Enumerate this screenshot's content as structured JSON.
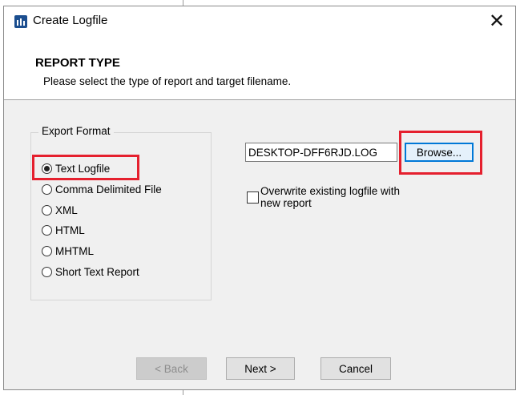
{
  "window": {
    "title": "Create Logfile",
    "close_glyph": "✕"
  },
  "header": {
    "title": "REPORT TYPE",
    "subtitle": "Please select the type of report and target filename."
  },
  "export_format": {
    "legend": "Export Format",
    "selected": "Text Logfile",
    "options": [
      {
        "label": "Text Logfile",
        "checked": true
      },
      {
        "label": "Comma Delimited File",
        "checked": false
      },
      {
        "label": "XML",
        "checked": false
      },
      {
        "label": "HTML",
        "checked": false
      },
      {
        "label": "MHTML",
        "checked": false
      },
      {
        "label": "Short Text Report",
        "checked": false
      }
    ]
  },
  "target": {
    "filename": "DESKTOP-DFF6RJD.LOG",
    "browse_label": "Browse...",
    "overwrite_label": "Overwrite existing logfile with new report",
    "overwrite_checked": false
  },
  "footer": {
    "back_label": "< Back",
    "next_label": "Next >",
    "cancel_label": "Cancel"
  },
  "highlights": {
    "color": "#e5202e"
  },
  "colors": {
    "accent": "#0078d7",
    "dialog_bg": "#f0f0f0",
    "app_icon": "#1b4e8f"
  }
}
